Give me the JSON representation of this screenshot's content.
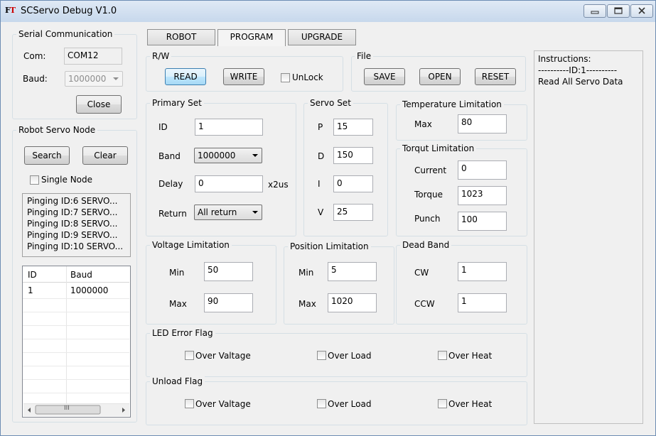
{
  "window": {
    "title": "SCServo Debug V1.0",
    "logo": "FT"
  },
  "serial": {
    "title": "Serial Communication",
    "com_label": "Com:",
    "com_value": "COM12",
    "baud_label": "Baud:",
    "baud_value": "1000000",
    "close_label": "Close"
  },
  "node": {
    "title": "Robot Servo Node",
    "search_label": "Search",
    "clear_label": "Clear",
    "single_node_label": "Single Node",
    "log": [
      "Pinging ID:6 SERVO...",
      "Pinging ID:7 SERVO...",
      "Pinging ID:8 SERVO...",
      "Pinging ID:9 SERVO...",
      "Pinging ID:10 SERVO..."
    ],
    "table": {
      "headers": [
        "ID",
        "Baud"
      ],
      "rows": [
        [
          "1",
          "1000000"
        ]
      ]
    },
    "scroll_glyph": "III"
  },
  "tabs": [
    "ROBOT",
    "PROGRAM",
    "UPGRADE"
  ],
  "rw": {
    "title": "R/W",
    "read_label": "READ",
    "write_label": "WRITE",
    "unlock_label": "UnLock"
  },
  "file": {
    "title": "File",
    "save_label": "SAVE",
    "open_label": "OPEN",
    "reset_label": "RESET"
  },
  "primary": {
    "title": "Primary Set",
    "id_label": "ID",
    "id_value": "1",
    "band_label": "Band",
    "band_value": "1000000",
    "delay_label": "Delay",
    "delay_value": "0",
    "delay_unit": "x2us",
    "return_label": "Return",
    "return_value": "All return"
  },
  "servo": {
    "title": "Servo Set",
    "p_label": "P",
    "p_value": "15",
    "d_label": "D",
    "d_value": "150",
    "i_label": "I",
    "i_value": "0",
    "v_label": "V",
    "v_value": "25"
  },
  "temperature": {
    "title": "Temperature Limitation",
    "max_label": "Max",
    "max_value": "80"
  },
  "torque": {
    "title": "Torqut Limitation",
    "current_label": "Current",
    "current_value": "0",
    "torque_label": "Torque",
    "torque_value": "1023",
    "punch_label": "Punch",
    "punch_value": "100"
  },
  "voltage": {
    "title": "Voltage Limitation",
    "min_label": "Min",
    "min_value": "50",
    "max_label": "Max",
    "max_value": "90"
  },
  "position": {
    "title": "Position Limitation",
    "min_label": "Min",
    "min_value": "5",
    "max_label": "Max",
    "max_value": "1020"
  },
  "deadband": {
    "title": "Dead Band",
    "cw_label": "CW",
    "cw_value": "1",
    "ccw_label": "CCW",
    "ccw_value": "1"
  },
  "led_flag": {
    "title": "LED Error Flag",
    "over_voltage": "Over Valtage",
    "over_load": "Over Load",
    "over_heat": "Over Heat"
  },
  "unload_flag": {
    "title": "Unload Flag",
    "over_voltage": "Over Valtage",
    "over_load": "Over Load",
    "over_heat": "Over Heat"
  },
  "instructions": {
    "header": "Instructions:",
    "line1": "----------ID:1----------",
    "line2": "Read All Servo Data"
  }
}
